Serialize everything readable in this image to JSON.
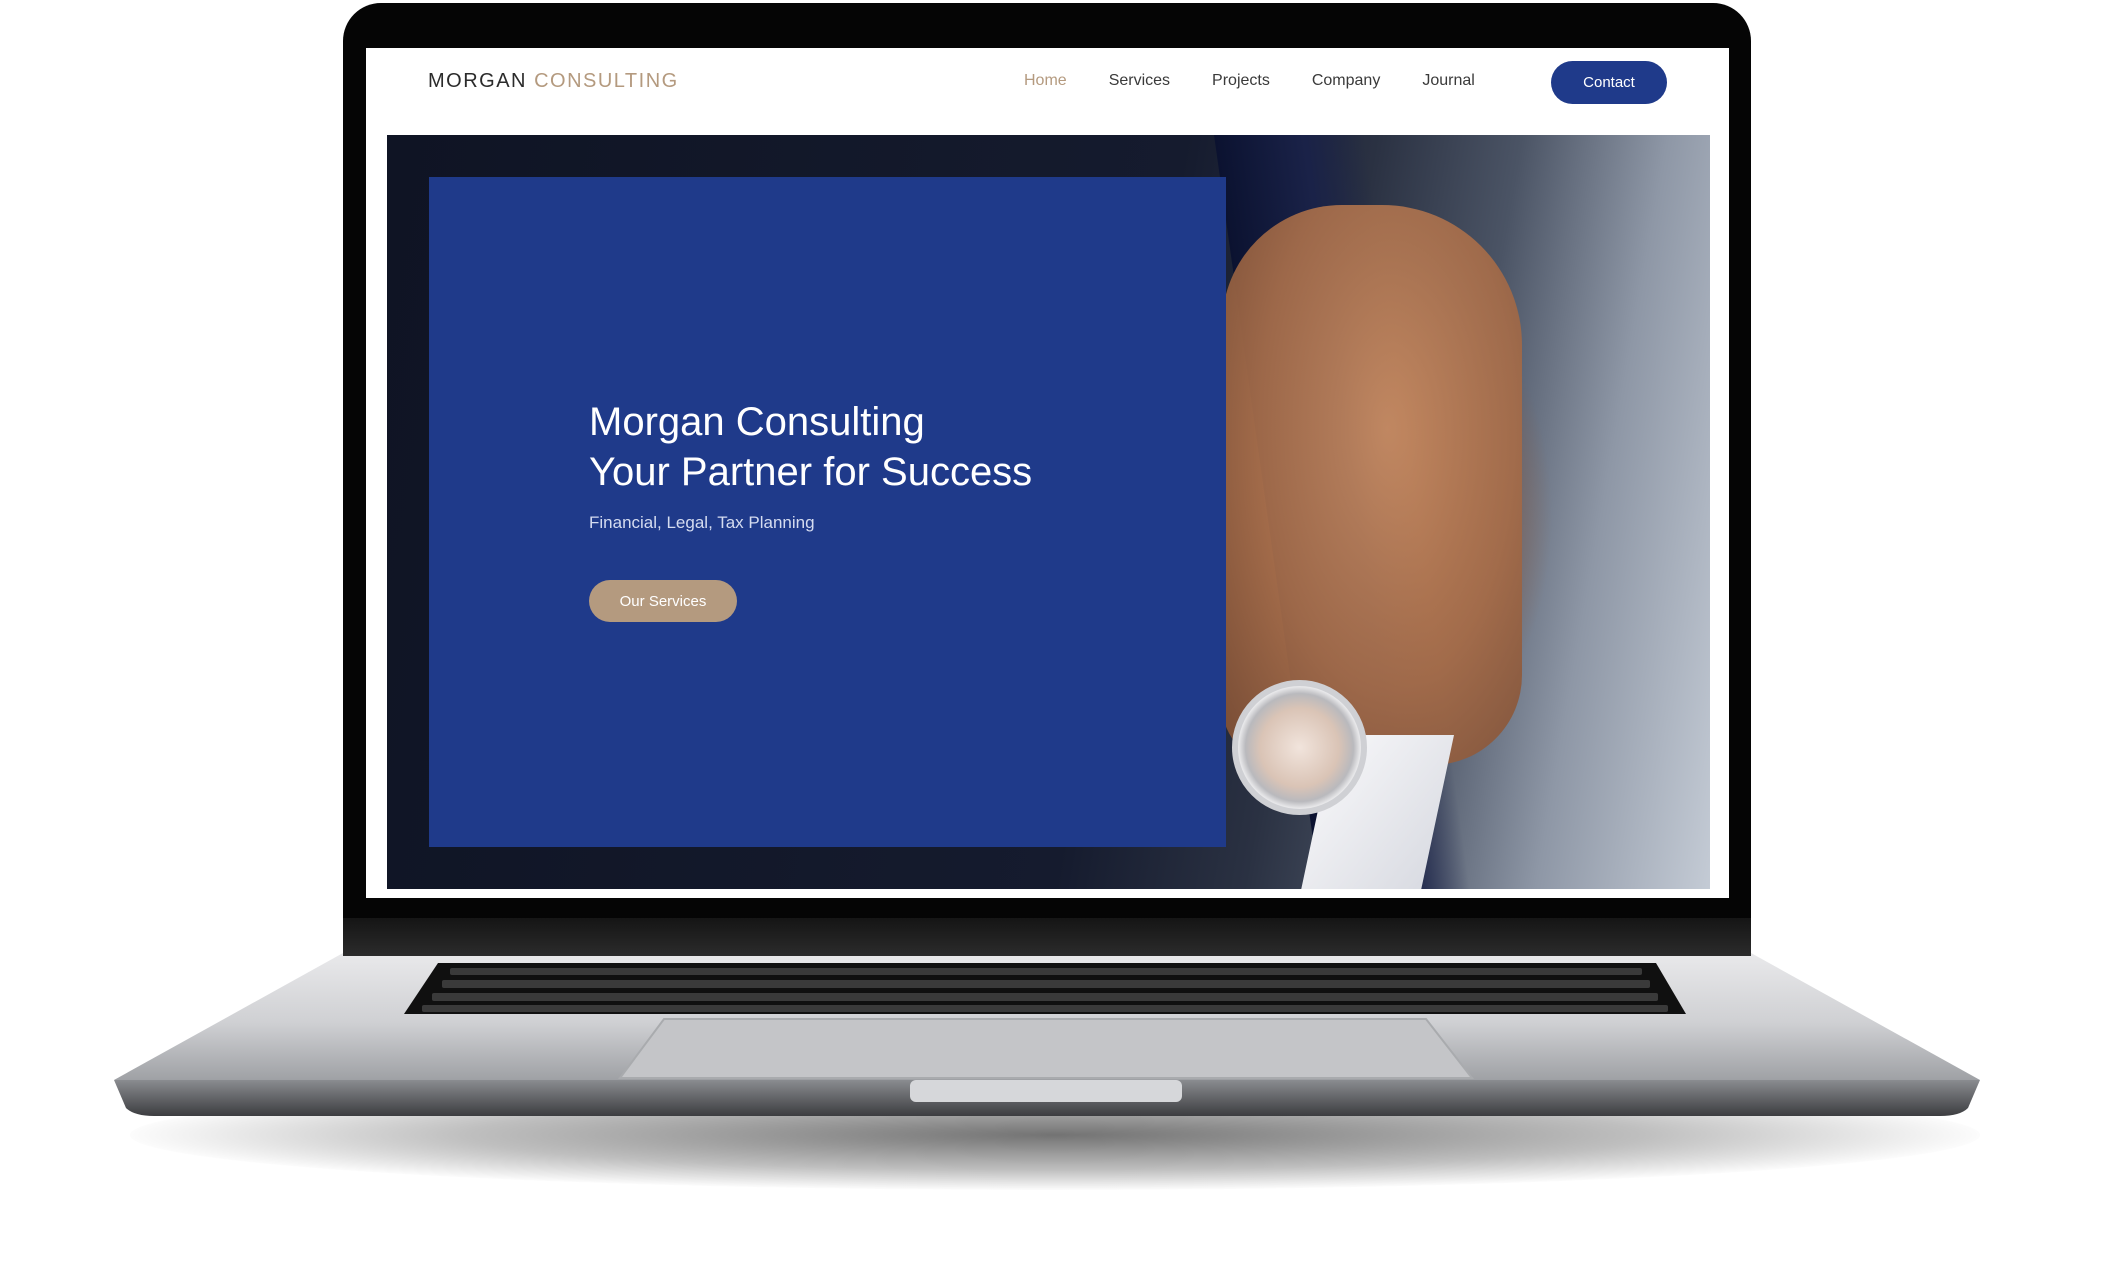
{
  "brand": {
    "name_part1": "MORGAN",
    "name_part2": "CONSULTING"
  },
  "nav": {
    "items": [
      {
        "label": "Home",
        "active": true
      },
      {
        "label": "Services",
        "active": false
      },
      {
        "label": "Projects",
        "active": false
      },
      {
        "label": "Company",
        "active": false
      },
      {
        "label": "Journal",
        "active": false
      }
    ],
    "contact_label": "Contact"
  },
  "hero": {
    "title_line1": "Morgan Consulting",
    "title_line2": "Your Partner for Success",
    "subtitle": "Financial, Legal, Tax Planning",
    "cta_label": "Our Services"
  },
  "colors": {
    "primary": "#1f3a8a",
    "accent": "#b49a7f",
    "text": "#3a3a3a"
  }
}
